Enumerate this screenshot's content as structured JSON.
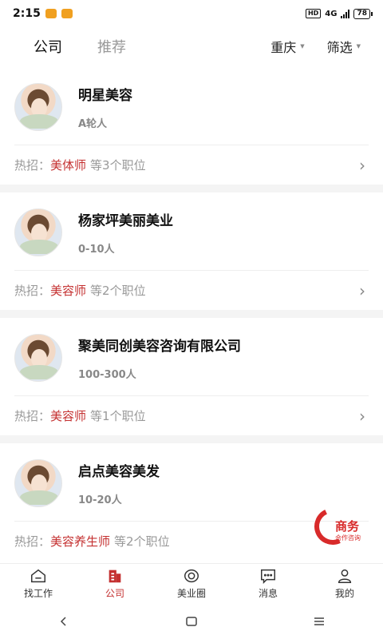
{
  "status_bar": {
    "time": "2:15",
    "hd": "HD",
    "network": "4G",
    "battery": "78"
  },
  "header": {
    "tabs": [
      {
        "label": "公司",
        "active": true
      },
      {
        "label": "推荐",
        "active": false
      }
    ],
    "city": "重庆",
    "filter": "筛选"
  },
  "companies": [
    {
      "name": "明星美容",
      "size": "A轮人",
      "hot_prefix": "热招：",
      "hot_role": "美体师",
      "hot_suffix": "等3个职位"
    },
    {
      "name": "杨家坪美丽美业",
      "size": "0-10人",
      "hot_prefix": "热招：",
      "hot_role": "美容师",
      "hot_suffix": "等2个职位"
    },
    {
      "name": "聚美同创美容咨询有限公司",
      "size": "100-300人",
      "hot_prefix": "热招：",
      "hot_role": "美容师",
      "hot_suffix": "等1个职位"
    },
    {
      "name": "启点美容美发",
      "size": "10-20人",
      "hot_prefix": "热招：",
      "hot_role": "美容养生师",
      "hot_suffix": "等2个职位"
    }
  ],
  "biz_badge": {
    "title": "商务",
    "subtitle": "合作咨询"
  },
  "bottom_nav": [
    {
      "label": "找工作",
      "icon": "home-icon",
      "active": false
    },
    {
      "label": "公司",
      "icon": "company-icon",
      "active": true
    },
    {
      "label": "美业圈",
      "icon": "circle-icon",
      "active": false
    },
    {
      "label": "消息",
      "icon": "message-icon",
      "active": false
    },
    {
      "label": "我的",
      "icon": "person-icon",
      "active": false
    }
  ],
  "colors": {
    "accent": "#c43030",
    "muted": "#999999",
    "separator": "#f4f4f4"
  }
}
